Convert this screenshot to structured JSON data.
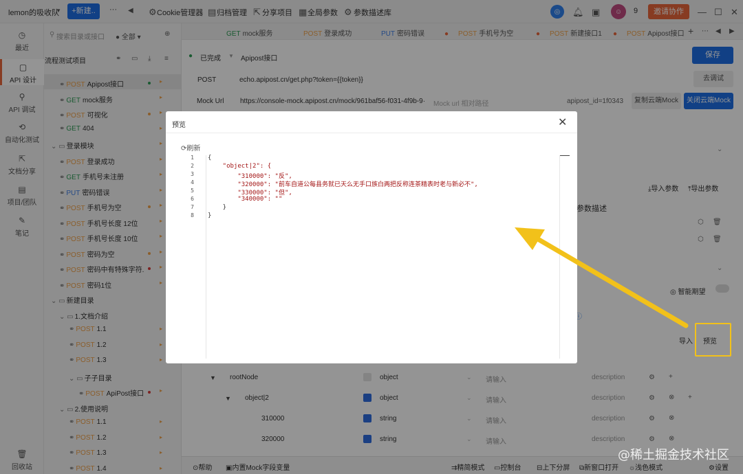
{
  "topbar": {
    "team": "lemon的吸收队",
    "new_label": "+新建..",
    "more": "···",
    "menu": [
      "Cookie管理器",
      "归档管理",
      "分享项目",
      "全局参数",
      "参数描述库"
    ],
    "count": "9",
    "invite": "邀请协作"
  },
  "rail": [
    {
      "icon": "clock-icon",
      "label": "最近"
    },
    {
      "icon": "api-design-icon",
      "label": "API 设计"
    },
    {
      "icon": "api-debug-icon",
      "label": "API 调试"
    },
    {
      "icon": "auto-test-icon",
      "label": "自动化测试"
    },
    {
      "icon": "doc-share-icon",
      "label": "文档分享"
    },
    {
      "icon": "project-team-icon",
      "label": "项目/团队"
    },
    {
      "icon": "notes-icon",
      "label": "笔记"
    },
    {
      "icon": "recycle-icon",
      "label": "回收站"
    }
  ],
  "tree": {
    "search_placeholder": "搜索目录或接口",
    "filter": "全部",
    "title": "流程测试项目",
    "items": [
      {
        "method": "POST",
        "name": "Apipost接口"
      },
      {
        "method": "GET",
        "name": "mock服务"
      },
      {
        "method": "POST",
        "name": "可视化"
      },
      {
        "method": "GET",
        "name": "404"
      },
      {
        "method": "",
        "name": "登录模块"
      },
      {
        "method": "POST",
        "name": "登录成功"
      },
      {
        "method": "GET",
        "name": "手机号未注册"
      },
      {
        "method": "PUT",
        "name": "密码错误"
      },
      {
        "method": "POST",
        "name": "手机号为空"
      },
      {
        "method": "POST",
        "name": "手机号长度 12位"
      },
      {
        "method": "POST",
        "name": "手机号长度 10位"
      },
      {
        "method": "POST",
        "name": "密码为空"
      },
      {
        "method": "POST",
        "name": "密码中有特殊字符."
      },
      {
        "method": "POST",
        "name": "密码1位"
      },
      {
        "method": "",
        "name": "新建目录"
      },
      {
        "method": "",
        "name": "1.文档介绍"
      },
      {
        "method": "POST",
        "name": "1.1"
      },
      {
        "method": "POST",
        "name": "1.2"
      },
      {
        "method": "POST",
        "name": "1.3"
      },
      {
        "method": "",
        "name": "子子目录"
      },
      {
        "method": "POST",
        "name": "ApiPost接口"
      },
      {
        "method": "",
        "name": "2.使用说明"
      },
      {
        "method": "POST",
        "name": "1.1"
      },
      {
        "method": "POST",
        "name": "1.2"
      },
      {
        "method": "POST",
        "name": "1.3"
      },
      {
        "method": "POST",
        "name": "1.4"
      }
    ]
  },
  "tabs": [
    {
      "method": "GET",
      "name": "mock服务"
    },
    {
      "method": "POST",
      "name": "登录成功"
    },
    {
      "method": "PUT",
      "name": "密码错误"
    },
    {
      "method": "POST",
      "name": "手机号为空"
    },
    {
      "method": "POST",
      "name": "新建接口1"
    },
    {
      "method": "POST",
      "name": "Apipost接口"
    }
  ],
  "request": {
    "status": "已完成",
    "name": "Apipost接口",
    "save": "保存",
    "method": "POST",
    "url": "echo.apipost.cn/get.php?token={{token}}",
    "send": "去调试",
    "mock_label": "Mock Url",
    "mock_url": "https://console-mock.apipost.cn/mock/961baf56-f031-4f9b-9·",
    "mock_path_placeholder": "Mock url 相对路径",
    "apipost_id": "apipost_id=1f0343",
    "copy_mock": "复制云端Mock",
    "close_mock": "关闭云端Mock",
    "import_params": "导入参数",
    "export_params": "导出参数",
    "param_desc": "参数描述",
    "smart_expect": "智能期望",
    "import": "导入",
    "preview": "预览"
  },
  "params_table": [
    {
      "name": "rootNode",
      "type": "object",
      "desc_placeholder": "请输入",
      "description": "description",
      "checked": false
    },
    {
      "name": "object|2",
      "type": "object",
      "desc_placeholder": "请输入",
      "description": "description",
      "checked": true
    },
    {
      "name": "310000",
      "type": "string",
      "desc_placeholder": "请输入",
      "description": "description",
      "checked": true
    },
    {
      "name": "320000",
      "type": "string",
      "desc_placeholder": "请输入",
      "description": "description",
      "checked": true
    }
  ],
  "bottombar": [
    "帮助",
    "内置Mock字段变量",
    "精简模式",
    "控制台",
    "上下分屏",
    "新窗口打开",
    "浅色模式",
    "设置"
  ],
  "modal": {
    "title": "预览",
    "refresh": "刷新",
    "code_lines": [
      "{",
      "    \"object|2\": {",
      "        \"310000\": \"反\",",
      "        \"320000\": \"前车自道公每县务就已天么无手口族白两把反称连茶精表时老与新必不\",",
      "        \"330000\": \"但\",",
      "        \"340000\": \"\"",
      "    }",
      "}"
    ]
  },
  "watermark": "@稀土掘金技术社区",
  "colors": {
    "accent": "#1e6fe6",
    "post": "#f0a24a",
    "get": "#2e9b55",
    "put": "#3f7fe6",
    "invite": "#e8673c",
    "arrow": "#f2c11a"
  }
}
